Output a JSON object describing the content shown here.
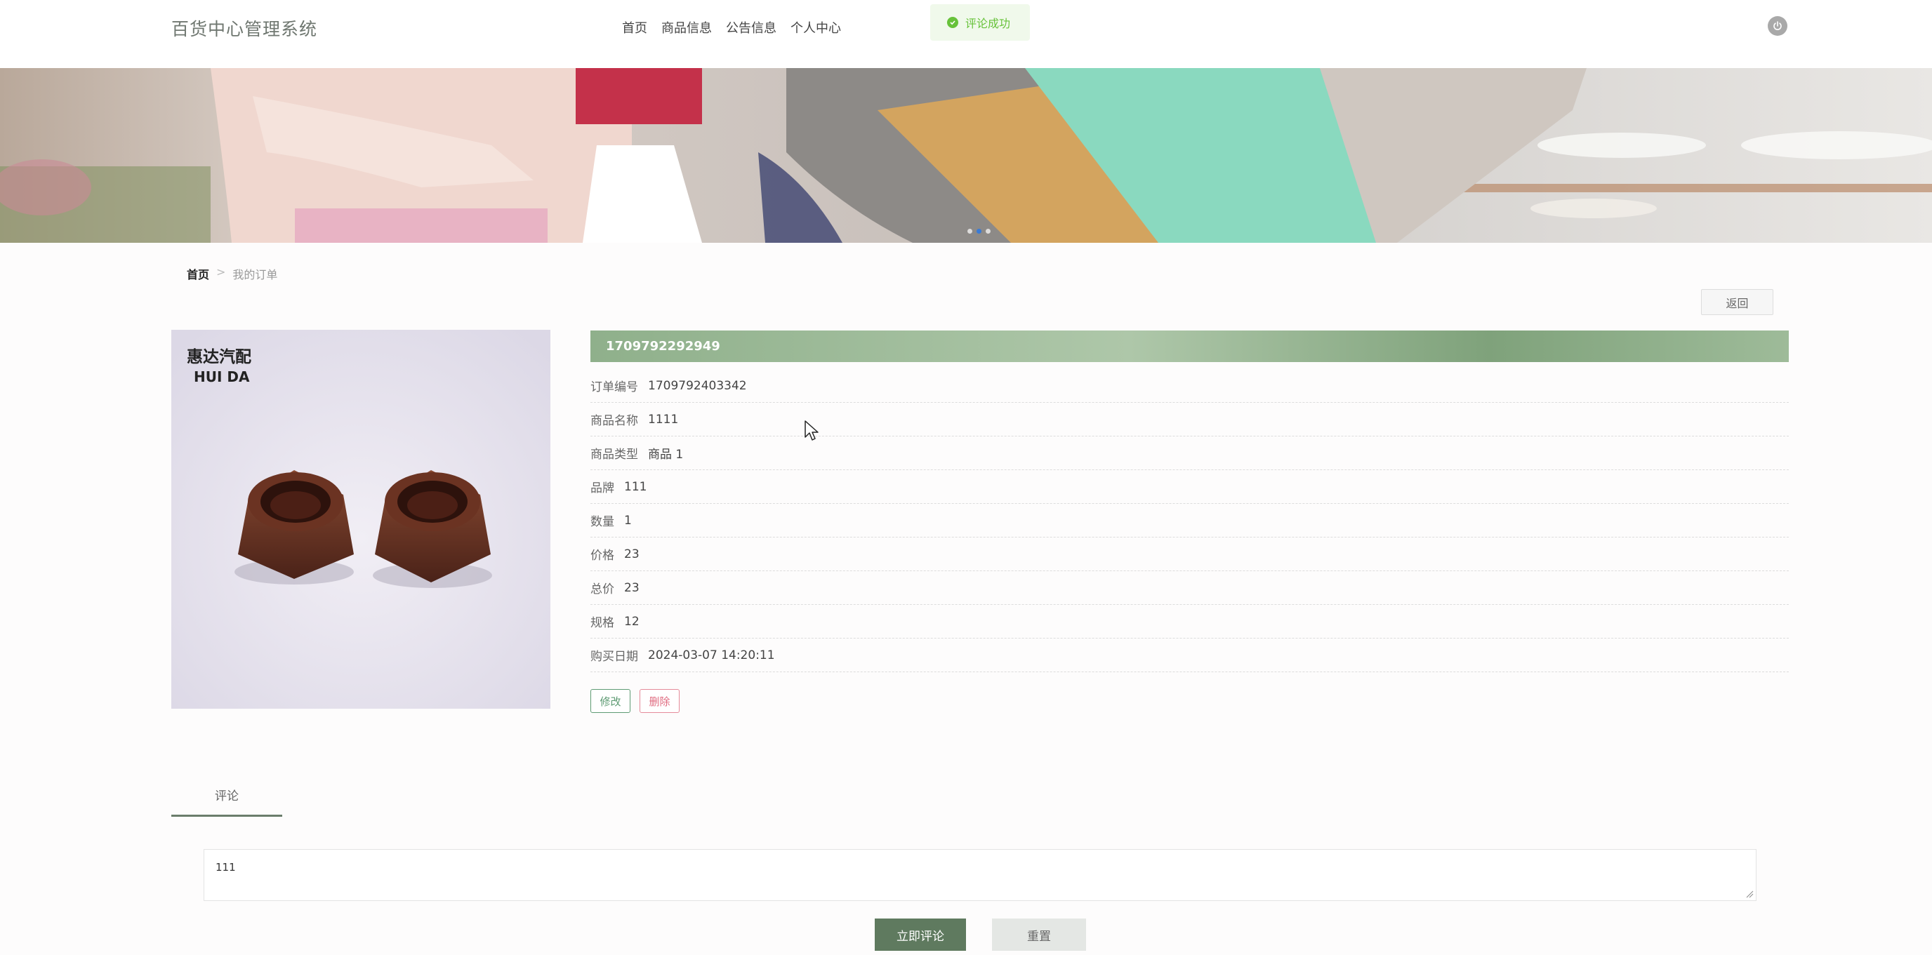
{
  "header": {
    "brand": "百货中心管理系统",
    "nav": [
      "首页",
      "商品信息",
      "公告信息",
      "个人中心"
    ],
    "toast": "评论成功"
  },
  "breadcrumb": {
    "home": "首页",
    "separator": ">",
    "current": "我的订单"
  },
  "back_button": "返回",
  "product_image": {
    "brand_cn": "惠达汽配",
    "brand_en": "HUI DA"
  },
  "order": {
    "title": "1709792292949",
    "fields": [
      {
        "label": "订单编号",
        "value": "1709792403342"
      },
      {
        "label": "商品名称",
        "value": "1111"
      },
      {
        "label": "商品类型",
        "value": "商品 1"
      },
      {
        "label": "品牌",
        "value": "111"
      },
      {
        "label": "数量",
        "value": "1"
      },
      {
        "label": "价格",
        "value": "23"
      },
      {
        "label": "总价",
        "value": "23"
      },
      {
        "label": "规格",
        "value": "12"
      },
      {
        "label": "购买日期",
        "value": "2024-03-07 14:20:11"
      }
    ],
    "edit_label": "修改",
    "delete_label": "删除"
  },
  "comments": {
    "tab_label": "评论",
    "input_value": "111",
    "submit_label": "立即评论",
    "reset_label": "重置"
  },
  "colors": {
    "accent_green": "#5f7a5f",
    "title_bar": "#8fb08b",
    "success": "#67c23a",
    "danger": "#e06b80"
  }
}
